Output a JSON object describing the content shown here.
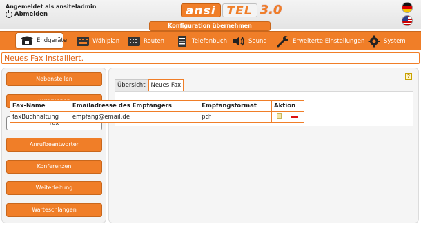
{
  "header": {
    "login_text": "Angemeldet als ansiteladmin",
    "logout_label": "Abmelden",
    "logo": {
      "part1": "ansi",
      "part2": "TEL",
      "version": "3.0"
    },
    "config_button": "Konfiguration übernehmen",
    "languages": [
      "de",
      "en"
    ]
  },
  "nav": {
    "items": [
      {
        "label": "Endgeräte",
        "icon": "telephone-icon",
        "active": true
      },
      {
        "label": "Wählplan",
        "icon": "dialplan-icon"
      },
      {
        "label": "Routen",
        "icon": "routes-icon"
      },
      {
        "label": "Telefonbuch",
        "icon": "phonebook-icon"
      },
      {
        "label": "Sound",
        "icon": "speaker-icon"
      },
      {
        "label": "Erweiterte Einstellungen",
        "icon": "wrench-icon"
      },
      {
        "label": "System",
        "icon": "gear-icon"
      }
    ]
  },
  "message": "Neues Fax installiert.",
  "sidebar": {
    "items": [
      {
        "label": "Nebenstellen"
      },
      {
        "label": "Rufgruppen"
      },
      {
        "label": "Fax",
        "active": true
      },
      {
        "label": "Anrufbeantworter"
      },
      {
        "label": "Konferenzen"
      },
      {
        "label": "Weiterleitung"
      },
      {
        "label": "Warteschlangen"
      }
    ]
  },
  "main": {
    "help": "?",
    "tabs": [
      {
        "label": "Übersicht"
      },
      {
        "label": "Neues Fax",
        "active": true
      }
    ],
    "table": {
      "headers": [
        "Fax-Name",
        "Emailadresse des Empfängers",
        "Empfangsformat",
        "Aktion"
      ],
      "rows": [
        [
          "faxBuchhaltung",
          "empfang@email.de",
          "pdf"
        ]
      ]
    }
  },
  "colors": {
    "accent": "#f07e28",
    "accent_border": "#c9671c",
    "message_text": "#e0661b"
  }
}
